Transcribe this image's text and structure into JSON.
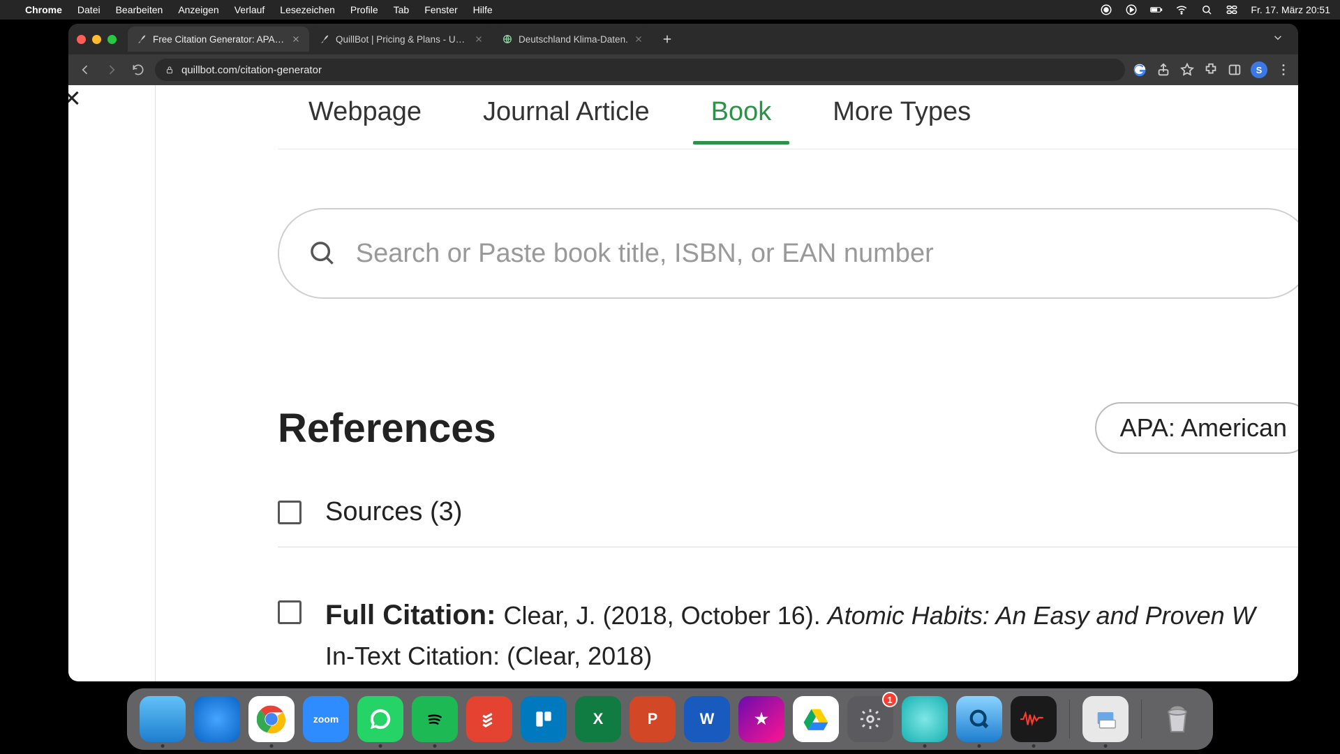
{
  "menubar": {
    "app": "Chrome",
    "items": [
      "Datei",
      "Bearbeiten",
      "Anzeigen",
      "Verlauf",
      "Lesezeichen",
      "Profile",
      "Tab",
      "Fenster",
      "Hilfe"
    ],
    "date": "Fr. 17. März 20:51"
  },
  "tabs": {
    "t0": {
      "title": "Free Citation Generator: APA, …"
    },
    "t1": {
      "title": "QuillBot | Pricing & Plans - Up…"
    },
    "t2": {
      "title": "Deutschland Klima-Daten."
    }
  },
  "omnibox": {
    "url": "quillbot.com/citation-generator"
  },
  "profile": {
    "initial": "S"
  },
  "sourceTabs": {
    "webpage": "Webpage",
    "journal": "Journal Article",
    "book": "Book",
    "more": "More Types"
  },
  "search": {
    "placeholder": "Search or Paste book title, ISBN, or EAN number"
  },
  "references": {
    "heading": "References",
    "stylePicker": "APA: American",
    "sourcesLabel": "Sources (3)",
    "citation1": {
      "labelFull": "Full Citation: ",
      "authorDate": "Clear, J. (2018, October 16). ",
      "titleItalic": "Atomic Habits: An Easy and Proven W",
      "labelInText": "In-Text Citation: ",
      "inText": "(Clear, 2018)"
    }
  },
  "dock": {
    "settingsBadge": "1"
  }
}
